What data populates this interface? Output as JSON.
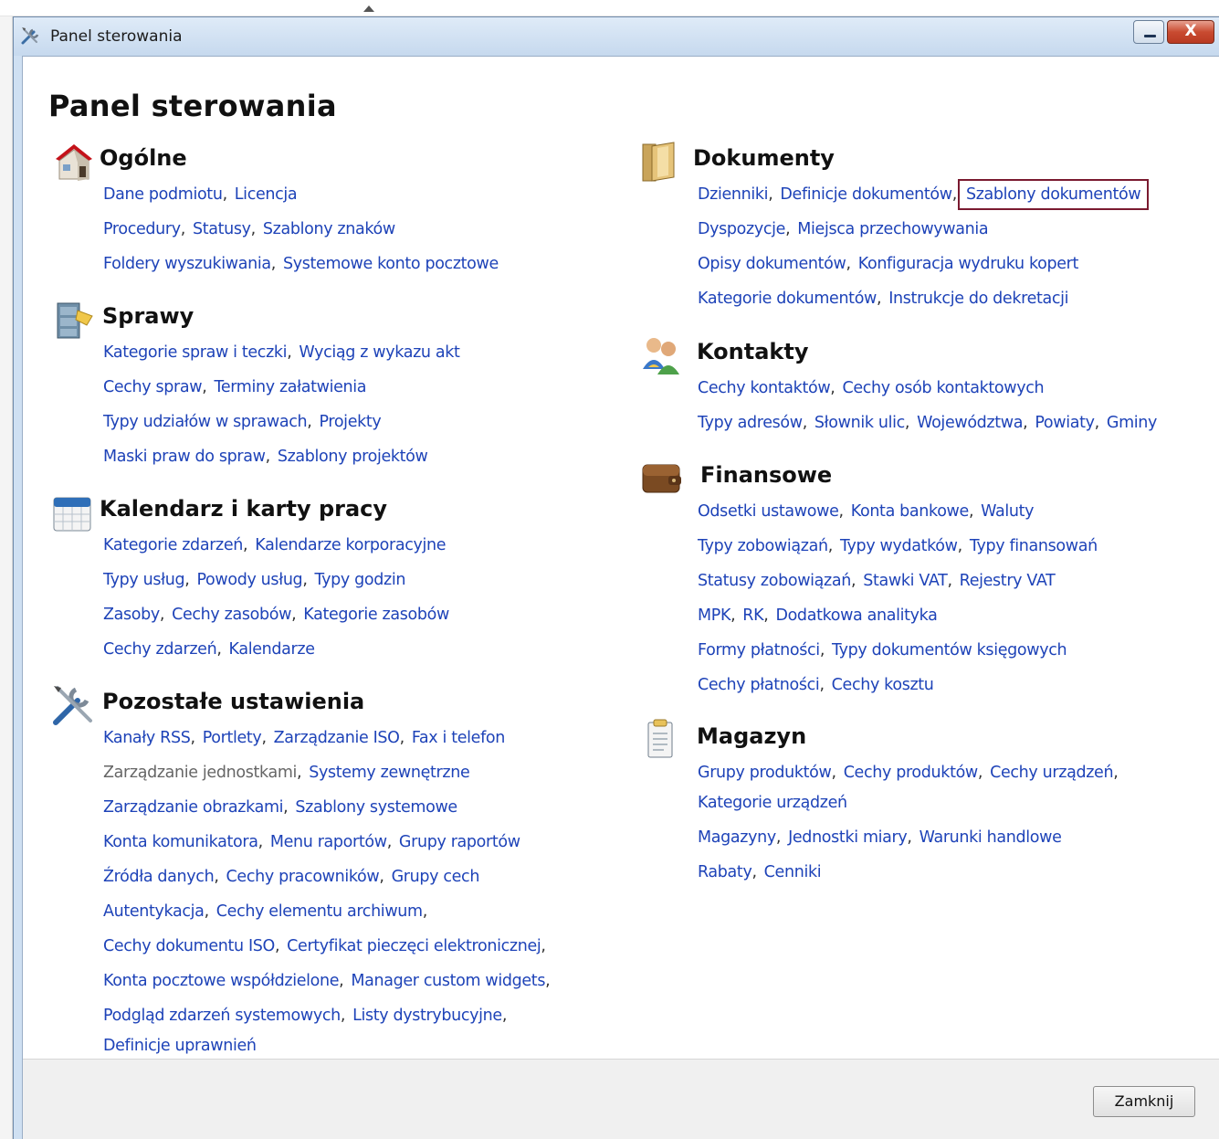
{
  "window": {
    "title": "Panel sterowania",
    "minimize_icon": "minimize-icon",
    "close_icon": "close-icon",
    "close_glyph": "X"
  },
  "page_title": "Panel sterowania",
  "left_sections": [
    {
      "key": "ogolne",
      "title": "Ogólne",
      "icon": "house-icon",
      "lines": [
        [
          "Dane podmiotu",
          "Licencja"
        ],
        [
          "Procedury",
          "Statusy",
          "Szablony znaków"
        ],
        [
          "Foldery wyszukiwania",
          "Systemowe konto pocztowe"
        ]
      ]
    },
    {
      "key": "sprawy",
      "title": "Sprawy",
      "icon": "cabinet-icon",
      "lines": [
        [
          "Kategorie spraw i teczki",
          "Wyciąg z wykazu akt"
        ],
        [
          "Cechy spraw",
          "Terminy załatwienia"
        ],
        [
          "Typy udziałów w sprawach",
          "Projekty"
        ],
        [
          "Maski praw do spraw",
          "Szablony projektów"
        ]
      ]
    },
    {
      "key": "kalendarz",
      "title": "Kalendarz i karty pracy",
      "icon": "calendar-icon",
      "lines": [
        [
          "Kategorie zdarzeń",
          "Kalendarze korporacyjne"
        ],
        [
          "Typy usług",
          "Powody usług",
          "Typy godzin"
        ],
        [
          "Zasoby",
          "Cechy zasobów",
          "Kategorie zasobów"
        ],
        [
          "Cechy zdarzeń",
          "Kalendarze"
        ]
      ]
    },
    {
      "key": "pozostale",
      "title": "Pozostałe ustawienia",
      "icon": "tools-icon",
      "lines": [
        [
          "Kanały RSS",
          "Portlety",
          "Zarządzanie ISO",
          "Fax i telefon"
        ],
        [
          "Zarządzanie jednostkami",
          "Systemy zewnętrzne"
        ],
        [
          "Zarządzanie obrazkami",
          "Szablony systemowe"
        ],
        [
          "Konta komunikatora",
          "Menu raportów",
          "Grupy raportów"
        ],
        [
          "Źródła danych",
          "Cechy pracowników",
          "Grupy cech"
        ],
        [
          "Autentykacja",
          "Cechy elementu archiwum",
          ""
        ],
        [
          "Cechy dokumentu ISO",
          "Certyfikat pieczęci elektronicznej",
          ""
        ],
        [
          "Konta pocztowe współdzielone",
          "Manager custom widgets",
          ""
        ],
        [
          "Podgląd zdarzeń systemowych",
          "Listy dystrybucyjne",
          ""
        ],
        [
          "Definicje uprawnień"
        ]
      ]
    }
  ],
  "right_sections": [
    {
      "key": "dokumenty",
      "title": "Dokumenty",
      "icon": "folder-icon",
      "lines": [
        [
          "Dzienniki",
          "Definicje dokumentów",
          "Szablony dokumentów"
        ],
        [
          "Dyspozycje",
          "Miejsca przechowywania"
        ],
        [
          "Opisy dokumentów",
          "Konfiguracja wydruku kopert"
        ],
        [
          "Kategorie dokumentów",
          "Instrukcje do dekretacji"
        ]
      ]
    },
    {
      "key": "kontakty",
      "title": "Kontakty",
      "icon": "contacts-icon",
      "lines": [
        [
          "Cechy kontaktów",
          "Cechy osób kontaktowych"
        ],
        [
          "Typy adresów",
          "Słownik ulic",
          "Województwa",
          "Powiaty",
          "Gminy"
        ]
      ]
    },
    {
      "key": "finansowe",
      "title": "Finansowe",
      "icon": "wallet-icon",
      "lines": [
        [
          "Odsetki ustawowe",
          "Konta bankowe",
          "Waluty"
        ],
        [
          "Typy zobowiązań",
          "Typy wydatków",
          "Typy finansowań"
        ],
        [
          "Statusy zobowiązań",
          "Stawki VAT",
          "Rejestry VAT"
        ],
        [
          "MPK",
          "RK",
          "Dodatkowa analityka"
        ],
        [
          "Formy płatności",
          "Typy dokumentów księgowych"
        ],
        [
          "Cechy płatności",
          "Cechy kosztu"
        ]
      ]
    },
    {
      "key": "magazyn",
      "title": "Magazyn",
      "icon": "clipboard-icon",
      "lines": [
        [
          "Grupy produktów",
          "Cechy produktów",
          "Cechy urządzeń",
          ""
        ],
        [
          "Kategorie urządzeń"
        ],
        [
          "Magazyny",
          "Jednostki miary",
          "Warunki handlowe"
        ],
        [
          "Rabaty",
          "Cenniki"
        ]
      ]
    }
  ],
  "highlighted_link": "Szablony dokumentów",
  "muted_link": "Zarządzanie jednostkami",
  "footer": {
    "close_label": "Zamknij"
  },
  "colors": {
    "link": "#1e43b8",
    "highlight_border": "#7a1a30",
    "titlebar": "#cfe0f2"
  }
}
